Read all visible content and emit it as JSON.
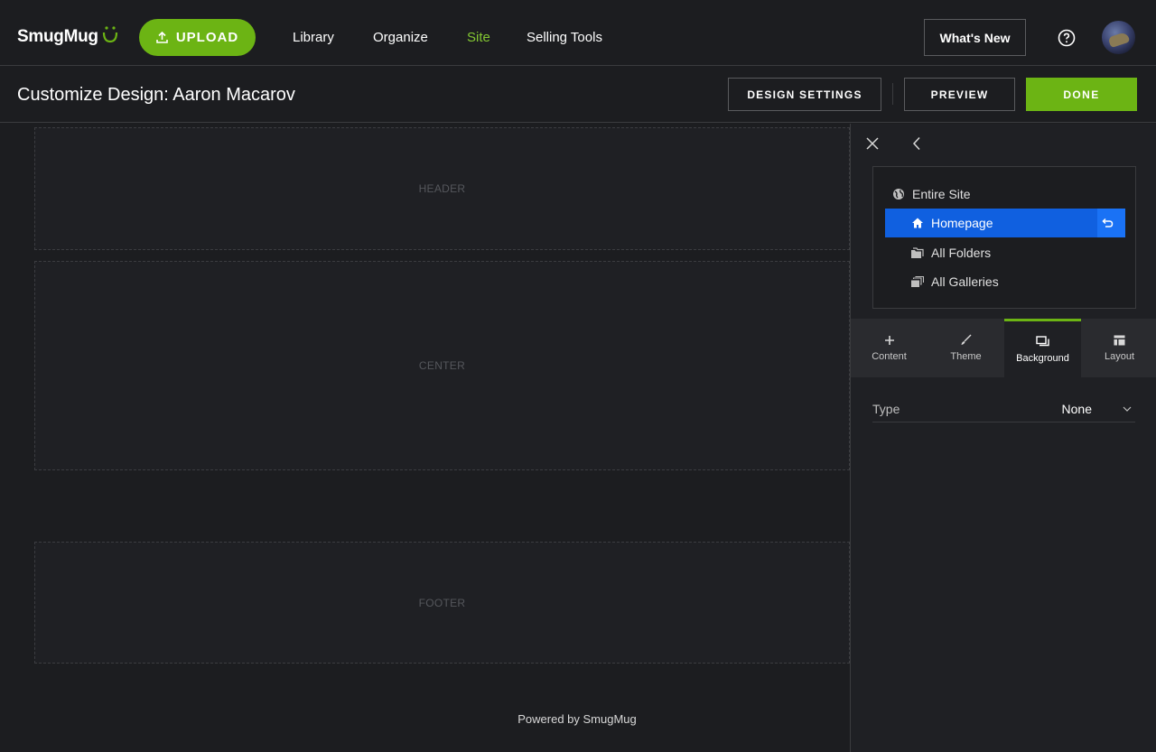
{
  "brand": {
    "name": "SmugMug",
    "accent": "#6cb414"
  },
  "topnav": {
    "upload_label": "UPLOAD",
    "links": [
      "Library",
      "Organize",
      "Site",
      "Selling Tools"
    ],
    "active_link": "Site",
    "whats_new_label": "What's New"
  },
  "subheader": {
    "title": "Customize Design: Aaron Macarov",
    "design_settings_label": "DESIGN SETTINGS",
    "preview_label": "PREVIEW",
    "done_label": "DONE"
  },
  "canvas": {
    "regions": {
      "header": "HEADER",
      "center": "CENTER",
      "footer": "FOOTER"
    },
    "powered_by": "Powered by SmugMug"
  },
  "panel": {
    "scopes": [
      {
        "label": "Entire Site",
        "icon": "globe-icon"
      },
      {
        "label": "Homepage",
        "icon": "home-icon",
        "selected": true
      },
      {
        "label": "All Folders",
        "icon": "folders-icon"
      },
      {
        "label": "All Galleries",
        "icon": "galleries-icon"
      }
    ],
    "tabs": [
      {
        "label": "Content",
        "icon": "plus-icon"
      },
      {
        "label": "Theme",
        "icon": "brush-icon"
      },
      {
        "label": "Background",
        "icon": "background-icon",
        "active": true
      },
      {
        "label": "Layout",
        "icon": "layout-icon"
      }
    ],
    "type_field": {
      "label": "Type",
      "value": "None"
    }
  }
}
